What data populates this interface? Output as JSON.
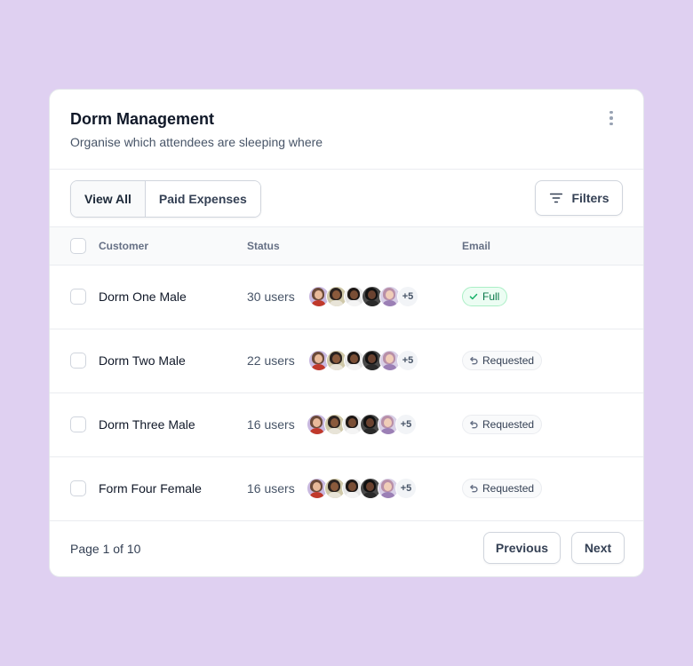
{
  "card": {
    "title": "Dorm Management",
    "subtitle": "Organise which attendees are sleeping where"
  },
  "toolbar": {
    "tabs": [
      {
        "label": "View All",
        "active": true
      },
      {
        "label": "Paid Expenses",
        "active": false
      }
    ],
    "filters_label": "Filters"
  },
  "table": {
    "headers": {
      "customer": "Customer",
      "status": "Status",
      "email": "Email"
    },
    "rows": [
      {
        "name": "Dorm One Male",
        "users": "30 users",
        "more": "+5",
        "badge": "Full",
        "badge_type": "full"
      },
      {
        "name": "Dorm Two Male",
        "users": "22 users",
        "more": "+5",
        "badge": "Requested",
        "badge_type": "requested"
      },
      {
        "name": "Dorm Three Male",
        "users": "16 users",
        "more": "+5",
        "badge": "Requested",
        "badge_type": "requested"
      },
      {
        "name": "Form Four Female",
        "users": "16 users",
        "more": "+5",
        "badge": "Requested",
        "badge_type": "requested"
      }
    ]
  },
  "pagination": {
    "page_info": "Page 1 of 10",
    "previous_label": "Previous",
    "next_label": "Next"
  },
  "colors": {
    "background": "#dfd0f1",
    "full_badge": "#067647",
    "requested_badge": "#344054"
  },
  "icons": {
    "menu": "kebab-vertical-icon",
    "filters": "filter-lines-icon",
    "full": "check-icon",
    "requested": "undo-arrow-icon"
  }
}
